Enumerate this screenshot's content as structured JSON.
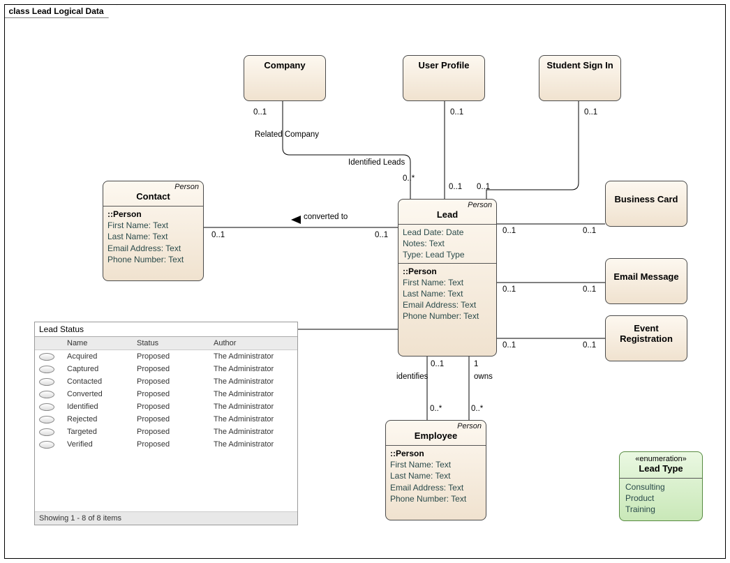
{
  "frame_title": "class Lead Logical Data",
  "stereotype_person": "Person",
  "boxes": {
    "company": "Company",
    "user_profile": "User Profile",
    "student_sign_in": "Student Sign In",
    "business_card": "Business Card",
    "email_message": "Email Message",
    "event_registration": "Event Registration",
    "contact": "Contact",
    "lead": "Lead",
    "employee": "Employee"
  },
  "lead_attrs": {
    "a0": "Lead Date: Date",
    "a1": "Notes: Text",
    "a2": "Type: Lead Type"
  },
  "person_section_header": "::Person",
  "person_attrs": {
    "p0": "First Name: Text",
    "p1": "Last Name: Text",
    "p2": "Email Address: Text",
    "p3": "Phone Number: Text"
  },
  "enum": {
    "stereo": "«enumeration»",
    "title": "Lead Type",
    "v0": "Consulting",
    "v1": "Product",
    "v2": "Training"
  },
  "labels": {
    "related_company": "Related Company",
    "identified_leads": "Identified Leads",
    "converted_to": "converted to",
    "identifies": "identifies",
    "owns": "owns",
    "m_0_1": "0..1",
    "m_0_star": "0..*",
    "m_1": "1"
  },
  "lead_status": {
    "title": "Lead Status",
    "cols": {
      "c0": "",
      "c1": "Name",
      "c2": "Status",
      "c3": "Author"
    },
    "rows": [
      {
        "name": "Acquired",
        "status": "Proposed",
        "author": "The Administrator"
      },
      {
        "name": "Captured",
        "status": "Proposed",
        "author": "The Administrator"
      },
      {
        "name": "Contacted",
        "status": "Proposed",
        "author": "The Administrator"
      },
      {
        "name": "Converted",
        "status": "Proposed",
        "author": "The Administrator"
      },
      {
        "name": "Identified",
        "status": "Proposed",
        "author": "The Administrator"
      },
      {
        "name": "Rejected",
        "status": "Proposed",
        "author": "The Administrator"
      },
      {
        "name": "Targeted",
        "status": "Proposed",
        "author": "The Administrator"
      },
      {
        "name": "Verified",
        "status": "Proposed",
        "author": "The Administrator"
      }
    ],
    "footer": "Showing  1 - 8 of 8 items"
  }
}
